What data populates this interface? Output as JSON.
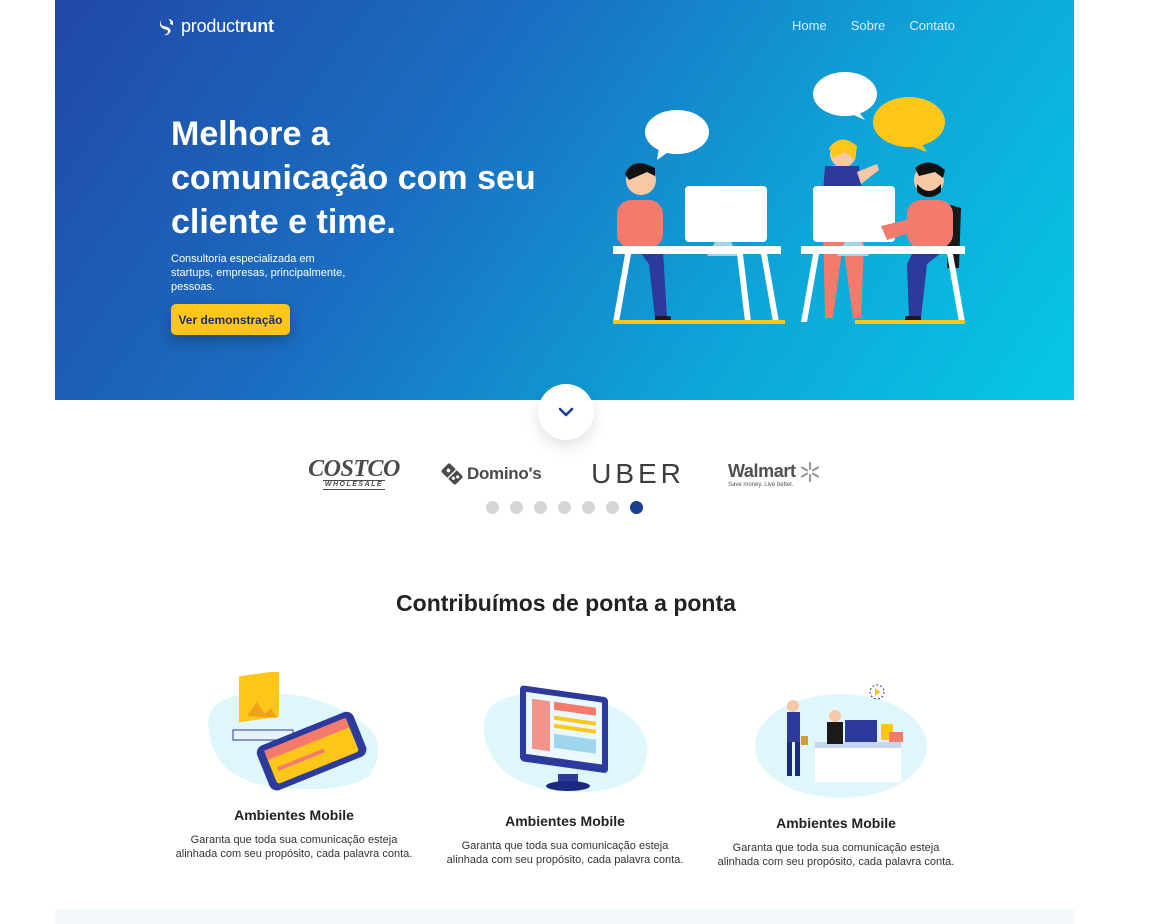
{
  "header": {
    "brand_light": "product",
    "brand_bold": "runt",
    "nav": [
      "Home",
      "Sobre",
      "Contato"
    ]
  },
  "hero": {
    "title_lines": [
      "Melhore a",
      "comunicação com seu",
      "cliente e time."
    ],
    "subtitle_lines": [
      "Consultoria especializada em",
      "startups, empresas, principalmente,",
      "pessoas."
    ],
    "cta_label": "Ver demonstração"
  },
  "brands": {
    "costco_main": "COSTCO",
    "costco_sub": "WHOLESALE",
    "dominos": "Domino's",
    "uber": "UBER",
    "walmart_main": "Walmart",
    "walmart_tagline": "Save money. Live better."
  },
  "carousel": {
    "dot_count": 7,
    "active_index": 6
  },
  "section": {
    "title": "Contribuímos de ponta a ponta"
  },
  "features": [
    {
      "title": "Ambientes Mobile",
      "desc_lines": [
        "Garanta que toda sua comunicação esteja",
        "alinhada com seu propósito, cada palavra conta."
      ]
    },
    {
      "title": "Ambientes Mobile",
      "desc_lines": [
        "Garanta que toda sua comunicação esteja",
        "alinhada com seu propósito, cada palavra conta."
      ]
    },
    {
      "title": "Ambientes Mobile",
      "desc_lines": [
        "Garanta que toda sua comunicação esteja",
        "alinhada com seu propósito, cada palavra conta."
      ]
    }
  ],
  "colors": {
    "hero_start": "#2148a6",
    "hero_end": "#07c8e4",
    "cta_bg": "#ffc61a",
    "active_dot": "#1b3f8f"
  },
  "icons": {
    "logo": "productrunt-logo-mark",
    "scroll": "chevron-down-icon"
  }
}
